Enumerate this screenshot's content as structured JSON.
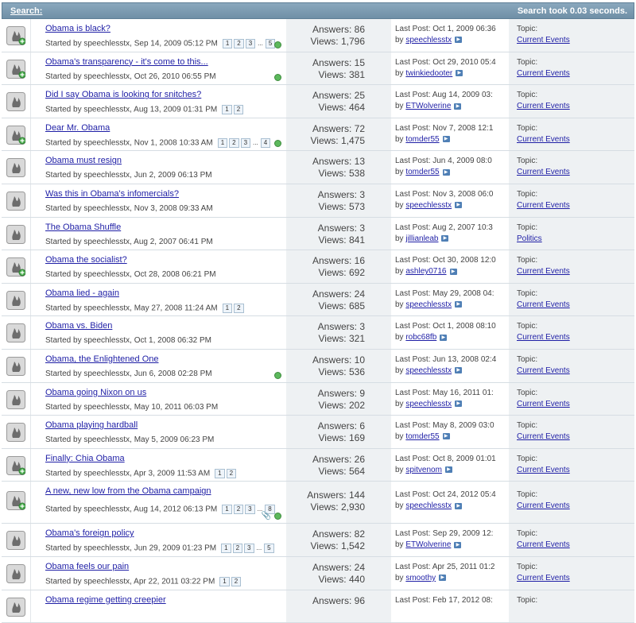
{
  "header": {
    "title": "Search:",
    "took": "Search took 0.03 seconds."
  },
  "rows": [
    {
      "title": "Obama is black?",
      "started": "Started by speechlesstx, Sep 14, 2009 05:12 PM",
      "pages": [
        "1",
        "2",
        "3",
        "...",
        "5"
      ],
      "check": true,
      "answers": "Answers: 86",
      "views": "Views: 1,796",
      "last": "Last Post: Oct 1, 2009 06:36",
      "by": "speechlesstx",
      "topic_label": "Topic:",
      "topic": "Current Events",
      "new": true
    },
    {
      "title": "Obama's transparency - it's come to this...",
      "started": "Started by speechlesstx, Oct 26, 2010 06:55 PM",
      "pages": [],
      "check": true,
      "answers": "Answers: 15",
      "views": "Views: 381",
      "last": "Last Post: Oct 29, 2010 05:4",
      "by": "twinkiedooter",
      "topic_label": "Topic:",
      "topic": "Current Events",
      "new": true
    },
    {
      "title": "Did I say Obama is looking for snitches?",
      "started": "Started by speechlesstx, Aug 13, 2009 01:31 PM",
      "pages": [
        "1",
        "2"
      ],
      "check": false,
      "answers": "Answers: 25",
      "views": "Views: 464",
      "last": "Last Post: Aug 14, 2009 03:",
      "by": "ETWolverine",
      "topic_label": "Topic:",
      "topic": "Current Events",
      "new": false
    },
    {
      "title": "Dear Mr. Obama",
      "started": "Started by speechlesstx, Nov 1, 2008 10:33 AM",
      "pages": [
        "1",
        "2",
        "3",
        "...",
        "4"
      ],
      "check": true,
      "answers": "Answers: 72",
      "views": "Views: 1,475",
      "last": "Last Post: Nov 7, 2008 12:1",
      "by": "tomder55",
      "topic_label": "Topic:",
      "topic": "Current Events",
      "new": true
    },
    {
      "title": "Obama must resign",
      "started": "Started by speechlesstx, Jun 2, 2009 06:13 PM",
      "pages": [],
      "check": false,
      "answers": "Answers: 13",
      "views": "Views: 538",
      "last": "Last Post: Jun 4, 2009 08:0",
      "by": "tomder55",
      "topic_label": "Topic:",
      "topic": "Current Events",
      "new": false
    },
    {
      "title": "Was this in Obama's infomercials?",
      "started": "Started by speechlesstx, Nov 3, 2008 09:33 AM",
      "pages": [],
      "check": false,
      "answers": "Answers: 3",
      "views": "Views: 573",
      "last": "Last Post: Nov 3, 2008 06:0",
      "by": "speechlesstx",
      "topic_label": "Topic:",
      "topic": "Current Events",
      "new": false
    },
    {
      "title": "The Obama Shuffle",
      "started": "Started by speechlesstx, Aug 2, 2007 06:41 PM",
      "pages": [],
      "check": false,
      "answers": "Answers: 3",
      "views": "Views: 841",
      "last": "Last Post: Aug 2, 2007 10:3",
      "by": "jillianleab",
      "topic_label": "Topic:",
      "topic": "Politics",
      "new": false
    },
    {
      "title": "Obama the socialist?",
      "started": "Started by speechlesstx, Oct 28, 2008 06:21 PM",
      "pages": [],
      "check": false,
      "answers": "Answers: 16",
      "views": "Views: 692",
      "last": "Last Post: Oct 30, 2008 12:0",
      "by": "ashley0716",
      "topic_label": "Topic:",
      "topic": "Current Events",
      "new": true
    },
    {
      "title": "Obama lied - again",
      "started": "Started by speechlesstx, May 27, 2008 11:24 AM",
      "pages": [
        "1",
        "2"
      ],
      "check": false,
      "answers": "Answers: 24",
      "views": "Views: 685",
      "last": "Last Post: May 29, 2008 04:",
      "by": "speechlesstx",
      "topic_label": "Topic:",
      "topic": "Current Events",
      "new": false
    },
    {
      "title": "Obama vs. Biden",
      "started": "Started by speechlesstx, Oct 1, 2008 06:32 PM",
      "pages": [],
      "check": false,
      "answers": "Answers: 3",
      "views": "Views: 321",
      "last": "Last Post: Oct 1, 2008 08:10",
      "by": "robc68fb",
      "topic_label": "Topic:",
      "topic": "Current Events",
      "new": false
    },
    {
      "title": "Obama, the Enlightened One",
      "started": "Started by speechlesstx, Jun 6, 2008 02:28 PM",
      "pages": [],
      "check": true,
      "answers": "Answers: 10",
      "views": "Views: 536",
      "last": "Last Post: Jun 13, 2008 02:4",
      "by": "speechlesstx",
      "topic_label": "Topic:",
      "topic": "Current Events",
      "new": false
    },
    {
      "title": "Obama going Nixon on us",
      "started": "Started by speechlesstx, May 10, 2011 06:03 PM",
      "pages": [],
      "check": false,
      "answers": "Answers: 9",
      "views": "Views: 202",
      "last": "Last Post: May 16, 2011 01:",
      "by": "speechlesstx",
      "topic_label": "Topic:",
      "topic": "Current Events",
      "new": false
    },
    {
      "title": "Obama playing hardball",
      "started": "Started by speechlesstx, May 5, 2009 06:23 PM",
      "pages": [],
      "check": false,
      "answers": "Answers: 6",
      "views": "Views: 169",
      "last": "Last Post: May 8, 2009 03:0",
      "by": "tomder55",
      "topic_label": "Topic:",
      "topic": "Current Events",
      "new": false
    },
    {
      "title": "Finally: Chia Obama",
      "started": "Started by speechlesstx, Apr 3, 2009 11:53 AM",
      "pages": [
        "1",
        "2"
      ],
      "check": false,
      "answers": "Answers: 26",
      "views": "Views: 564",
      "last": "Last Post: Oct 8, 2009 01:01",
      "by": "spitvenom",
      "topic_label": "Topic:",
      "topic": "Current Events",
      "new": true
    },
    {
      "title": "A new, new low from the Obama campaign",
      "started": "Started by speechlesstx, Aug 14, 2012 06:13 PM",
      "pages": [
        "1",
        "2",
        "3",
        "...",
        "8"
      ],
      "check": true,
      "clip": true,
      "answers": "Answers: 144",
      "views": "Views: 2,930",
      "last": "Last Post: Oct 24, 2012 05:4",
      "by": "speechlesstx",
      "topic_label": "Topic:",
      "topic": "Current Events",
      "new": true,
      "tall": true
    },
    {
      "title": "Obama's foreign policy",
      "started": "Started by speechlesstx, Jun 29, 2009 01:23 PM",
      "pages": [
        "1",
        "2",
        "3",
        "...",
        "5"
      ],
      "check": false,
      "answers": "Answers: 82",
      "views": "Views: 1,542",
      "last": "Last Post: Sep 29, 2009 12:",
      "by": "ETWolverine",
      "topic_label": "Topic:",
      "topic": "Current Events",
      "new": false
    },
    {
      "title": "Obama feels our pain",
      "started": "Started by speechlesstx, Apr 22, 2011 03:22 PM",
      "pages": [
        "1",
        "2"
      ],
      "check": false,
      "answers": "Answers: 24",
      "views": "Views: 440",
      "last": "Last Post: Apr 25, 2011 01:2",
      "by": "smoothy",
      "topic_label": "Topic:",
      "topic": "Current Events",
      "new": false
    },
    {
      "title": "Obama regime getting creepier",
      "started": "",
      "pages": [],
      "check": false,
      "answers": "Answers: 96",
      "views": "",
      "last": "Last Post: Feb 17, 2012 08:",
      "by": "",
      "topic_label": "Topic:",
      "topic": "",
      "new": false
    }
  ],
  "colors": {
    "header_bg": "#7b9ab0",
    "link": "#1f1fa6",
    "column_bg": "#eef1f3",
    "check": "#5cb85c"
  }
}
